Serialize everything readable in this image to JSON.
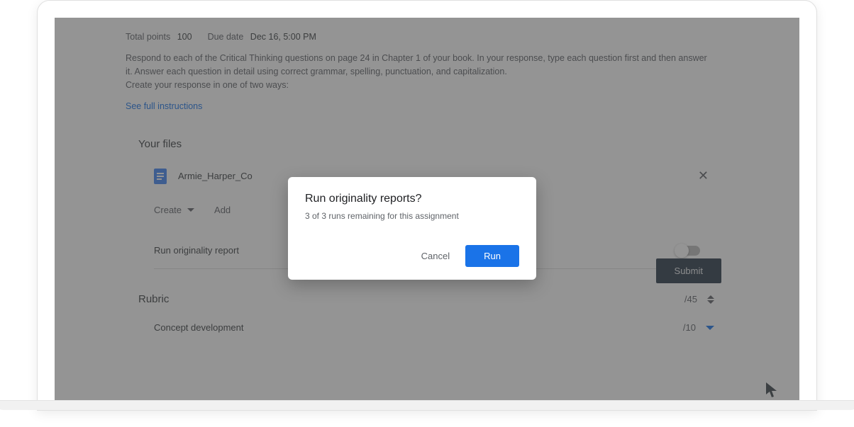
{
  "meta": {
    "points_label": "Total points",
    "points_value": "100",
    "due_label": "Due date",
    "due_value": "Dec 16, 5:00 PM"
  },
  "instructions": {
    "line1": "Respond to each of the Critical Thinking questions on page 24 in Chapter 1 of your book. In your response, type each question first and then answer it. Answer each question in detail using correct grammar, spelling, punctuation, and capitalization.",
    "line2": "Create your response in one of two ways:",
    "see_full": "See full instructions"
  },
  "files": {
    "section_title": "Your files",
    "file_name": "Armie_Harper_Co",
    "create_label": "Create",
    "add_label": "Add"
  },
  "originality": {
    "label": "Run originality report",
    "submit_label": "Submit"
  },
  "rubric": {
    "title": "Rubric",
    "total_score": "/45",
    "criterion1_name": "Concept development",
    "criterion1_score": "/10"
  },
  "dialog": {
    "title": "Run originality reports?",
    "subtitle": "3 of 3 runs remaining for this assignment",
    "cancel": "Cancel",
    "run": "Run"
  }
}
